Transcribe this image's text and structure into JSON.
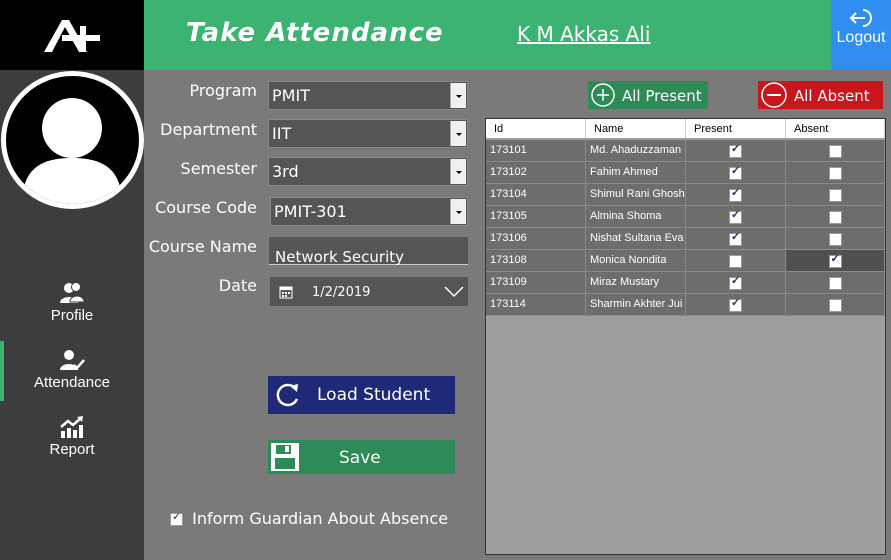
{
  "header": {
    "title": "Take Attendance",
    "user_name": "K M Akkas Ali",
    "logout_label": "Logout"
  },
  "sidebar": {
    "items": [
      {
        "label": "Profile",
        "icon": "users-icon"
      },
      {
        "label": "Attendance",
        "icon": "user-check-icon",
        "active": true
      },
      {
        "label": "Report",
        "icon": "chart-up-icon"
      }
    ]
  },
  "form": {
    "program_label": "Program",
    "program_value": "PMIT",
    "department_label": "Department",
    "department_value": "IIT",
    "semester_label": "Semester",
    "semester_value": "3rd",
    "course_code_label": "Course Code",
    "course_code_value": "PMIT-301",
    "course_name_label": "Course Name",
    "course_name_value": "Network Security",
    "date_label": "Date",
    "date_value": "1/2/2019",
    "load_button": "Load Student",
    "save_button": "Save",
    "inform_label": "Inform Guardian About Absence",
    "inform_checked": true
  },
  "actions": {
    "all_present": "All Present",
    "all_absent": "All Absent"
  },
  "table": {
    "columns": [
      "Id",
      "Name",
      "Present",
      "Absent"
    ],
    "rows": [
      {
        "id": "173101",
        "name": "Md. Ahaduzzaman",
        "present": true,
        "absent": false
      },
      {
        "id": "173102",
        "name": "Fahim Ahmed",
        "present": true,
        "absent": false
      },
      {
        "id": "173104",
        "name": "Shimul Rani Ghosh",
        "present": true,
        "absent": false
      },
      {
        "id": "173105",
        "name": "Almina Shoma",
        "present": true,
        "absent": false
      },
      {
        "id": "173106",
        "name": "Nishat Sultana Eva",
        "present": true,
        "absent": false
      },
      {
        "id": "173108",
        "name": "Monica Nondita",
        "present": false,
        "absent": true
      },
      {
        "id": "173109",
        "name": "Miraz Mustary",
        "present": true,
        "absent": false
      },
      {
        "id": "173114",
        "name": "Sharmin Akhter Jui",
        "present": true,
        "absent": false
      }
    ]
  },
  "colors": {
    "accent_green": "#3cb371",
    "logout_blue": "#2f8ef0",
    "absent_red": "#c8161d",
    "load_navy": "#1e2a78"
  }
}
